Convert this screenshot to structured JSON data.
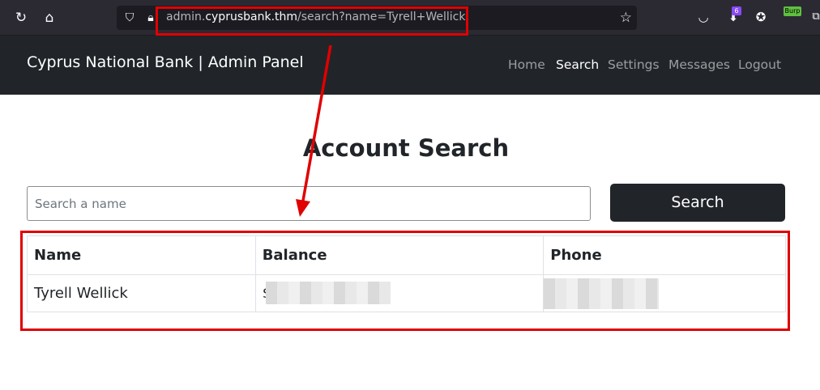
{
  "browser": {
    "url_host_prefix": "admin.",
    "url_host": "cyprusbank.thm",
    "url_path": "/search?name=Tyrell+Wellick",
    "extension_badge": "6",
    "burp_label": "Burp",
    "icons": [
      "reload-icon",
      "home-icon",
      "shield-icon",
      "lock-icon",
      "star-icon",
      "pocket-icon",
      "cookie-icon"
    ]
  },
  "site": {
    "brand": "Cyprus National Bank | Admin Panel",
    "nav": [
      {
        "label": "Home",
        "active": false
      },
      {
        "label": "Search",
        "active": true
      },
      {
        "label": "Settings",
        "active": false
      },
      {
        "label": "Messages",
        "active": false
      },
      {
        "label": "Logout",
        "active": false
      }
    ]
  },
  "main": {
    "title": "Account Search",
    "search_placeholder": "Search a name",
    "search_value": "",
    "search_button": "Search"
  },
  "table": {
    "headers": [
      "Name",
      "Balance",
      "Phone"
    ],
    "rows": [
      {
        "name": "Tyrell Wellick",
        "balance": "$",
        "balance_redacted": true,
        "phone": "",
        "phone_redacted": true
      }
    ]
  },
  "annotations": {
    "color": "#e00000"
  },
  "colors": {
    "navbar": "#212529",
    "browser": "#2b2a33",
    "button": "#212529"
  }
}
